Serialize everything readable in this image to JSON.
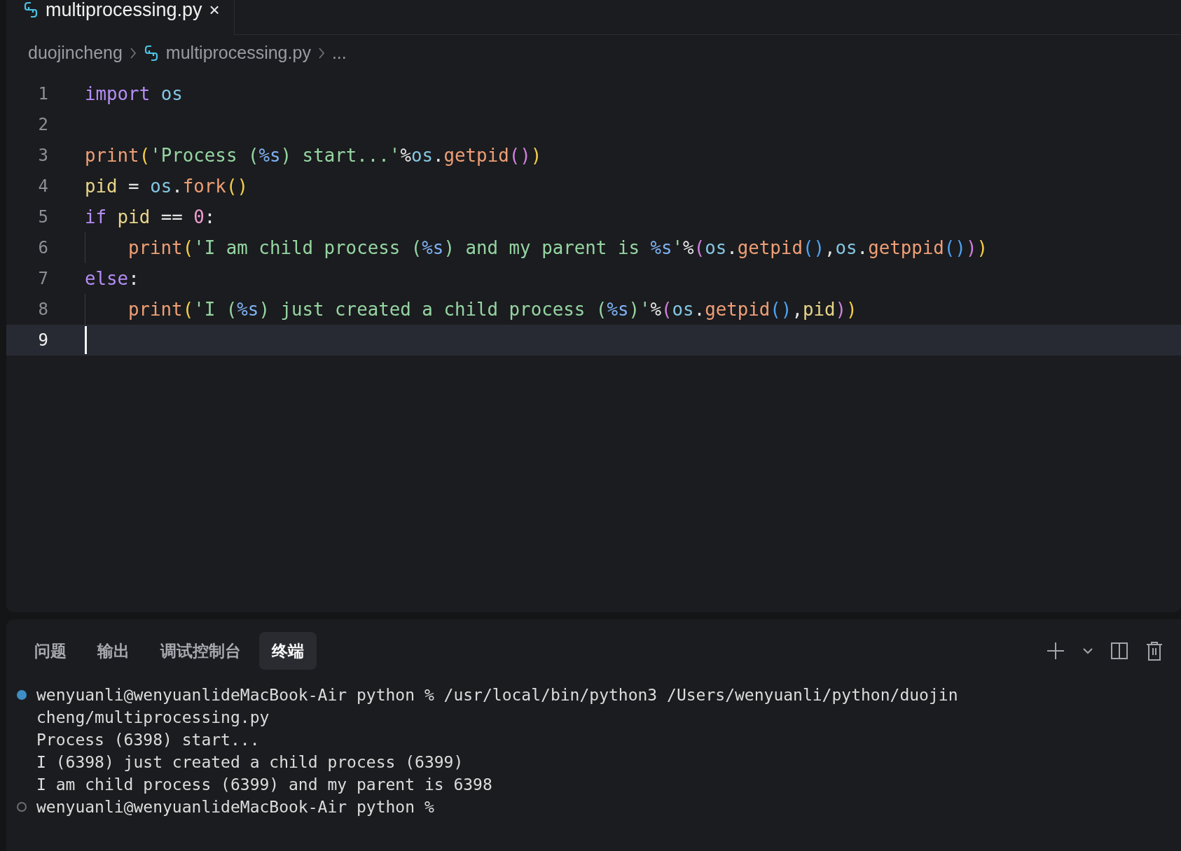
{
  "editor_tabs": [
    {
      "label": "multiprocessing.py",
      "close": "×",
      "selected": true
    }
  ],
  "breadcrumb": {
    "folder": "duojincheng",
    "file": "multiprocessing.py",
    "more": "..."
  },
  "code_lines": [
    {
      "number": "1",
      "current": false,
      "indent_guide": false,
      "tokens": [
        {
          "kind": "keyword",
          "text": "import "
        },
        {
          "kind": "module",
          "text": "os"
        }
      ]
    },
    {
      "number": "2",
      "current": false,
      "indent_guide": false
    },
    {
      "number": "3",
      "current": false,
      "indent_guide": false,
      "tokens": [
        {
          "kind": "func",
          "text": "print"
        },
        {
          "kind": "bracket1",
          "text": "("
        },
        {
          "kind": "string",
          "text": "'Process ("
        },
        {
          "kind": "format",
          "text": "%s"
        },
        {
          "kind": "string",
          "text": ") start...'"
        },
        {
          "kind": "plain",
          "text": "%"
        },
        {
          "kind": "module",
          "text": "os"
        },
        {
          "kind": "plain",
          "text": "."
        },
        {
          "kind": "func",
          "text": "getpid"
        },
        {
          "kind": "bracket2",
          "text": "()"
        },
        {
          "kind": "bracket1",
          "text": ")"
        }
      ]
    },
    {
      "number": "4",
      "current": false,
      "indent_guide": false,
      "tokens": [
        {
          "kind": "variable",
          "text": "pid"
        },
        {
          "kind": "plain",
          "text": " = "
        },
        {
          "kind": "module",
          "text": "os"
        },
        {
          "kind": "plain",
          "text": "."
        },
        {
          "kind": "func",
          "text": "fork"
        },
        {
          "kind": "bracket1",
          "text": "()"
        }
      ]
    },
    {
      "number": "5",
      "current": false,
      "indent_guide": false,
      "tokens": [
        {
          "kind": "keyword",
          "text": "if "
        },
        {
          "kind": "variable",
          "text": "pid"
        },
        {
          "kind": "plain",
          "text": " == "
        },
        {
          "kind": "number",
          "text": "0"
        },
        {
          "kind": "plain",
          "text": ":"
        }
      ]
    },
    {
      "number": "6",
      "current": false,
      "indent_guide": true,
      "tokens": [
        {
          "kind": "func",
          "text": "print"
        },
        {
          "kind": "bracket1",
          "text": "("
        },
        {
          "kind": "string",
          "text": "'I am child process ("
        },
        {
          "kind": "format",
          "text": "%s"
        },
        {
          "kind": "string",
          "text": ") and my parent is "
        },
        {
          "kind": "format",
          "text": "%s"
        },
        {
          "kind": "string",
          "text": "'"
        },
        {
          "kind": "plain",
          "text": "%"
        },
        {
          "kind": "bracket2",
          "text": "("
        },
        {
          "kind": "module",
          "text": "os"
        },
        {
          "kind": "plain",
          "text": "."
        },
        {
          "kind": "func",
          "text": "getpid"
        },
        {
          "kind": "bracket3",
          "text": "()"
        },
        {
          "kind": "plain",
          "text": ","
        },
        {
          "kind": "module",
          "text": "os"
        },
        {
          "kind": "plain",
          "text": "."
        },
        {
          "kind": "func",
          "text": "getppid"
        },
        {
          "kind": "bracket3",
          "text": "()"
        },
        {
          "kind": "bracket2",
          "text": ")"
        },
        {
          "kind": "bracket1",
          "text": ")"
        }
      ]
    },
    {
      "number": "7",
      "current": false,
      "indent_guide": false,
      "tokens": [
        {
          "kind": "keyword",
          "text": "else"
        },
        {
          "kind": "plain",
          "text": ":"
        }
      ]
    },
    {
      "number": "8",
      "current": false,
      "indent_guide": true,
      "tokens": [
        {
          "kind": "func",
          "text": "print"
        },
        {
          "kind": "bracket1",
          "text": "("
        },
        {
          "kind": "string",
          "text": "'I ("
        },
        {
          "kind": "format",
          "text": "%s"
        },
        {
          "kind": "string",
          "text": ") just created a child process ("
        },
        {
          "kind": "format",
          "text": "%s"
        },
        {
          "kind": "string",
          "text": ")'"
        },
        {
          "kind": "plain",
          "text": "%"
        },
        {
          "kind": "bracket2",
          "text": "("
        },
        {
          "kind": "module",
          "text": "os"
        },
        {
          "kind": "plain",
          "text": "."
        },
        {
          "kind": "func",
          "text": "getpid"
        },
        {
          "kind": "bracket3",
          "text": "()"
        },
        {
          "kind": "plain",
          "text": ","
        },
        {
          "kind": "variable",
          "text": "pid"
        },
        {
          "kind": "bracket2",
          "text": ")"
        },
        {
          "kind": "bracket1",
          "text": ")"
        }
      ]
    },
    {
      "number": "9",
      "current": true,
      "indent_guide": false
    }
  ],
  "panel_tabs": [
    {
      "label": "问题",
      "selected": false
    },
    {
      "label": "输出",
      "selected": false
    },
    {
      "label": "调试控制台",
      "selected": false
    },
    {
      "label": "终端",
      "selected": true
    }
  ],
  "terminal_lines": [
    {
      "kind": "finished_prompt",
      "text": "wenyuanli@wenyuanlideMacBook-Air python % /usr/local/bin/python3 /Users/wenyuanli/python/duojin"
    },
    {
      "kind": "output",
      "text": "cheng/multiprocessing.py"
    },
    {
      "kind": "output",
      "text": "Process (6398) start..."
    },
    {
      "kind": "output",
      "text": "I (6398) just created a child process (6399)"
    },
    {
      "kind": "output",
      "text": "I am child process (6399) and my parent is 6398"
    },
    {
      "kind": "idle_prompt",
      "text": "wenyuanli@wenyuanlideMacBook-Air python %"
    }
  ]
}
